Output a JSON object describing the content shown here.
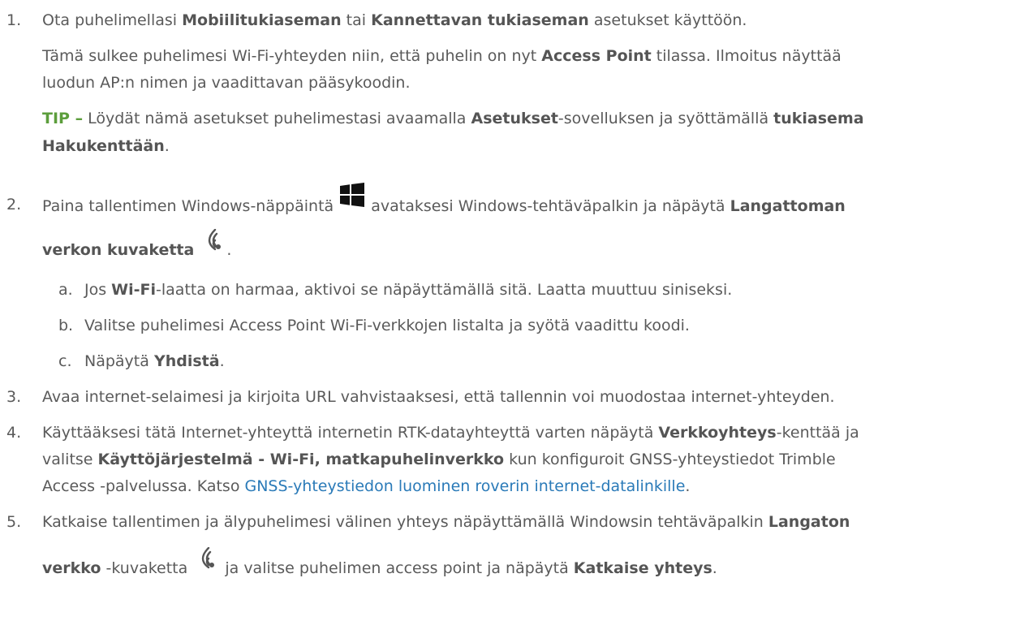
{
  "steps": [
    {
      "num": "1.",
      "l1_a": "Ota puhelimellasi ",
      "l1_b": "Mobiilitukiaseman",
      "l1_c": " tai ",
      "l1_d": "Kannettavan tukiaseman",
      "l1_e": " asetukset käyttöön.",
      "p_a": "Tämä sulkee puhelimesi Wi-Fi-yhteyden niin, että puhelin on nyt ",
      "p_b": "Access Point",
      "p_c": " tilassa. Ilmoitus näyttää",
      "p2": "luodun AP:n nimen ja vaadittavan pääsykoodin.",
      "tip": "TIP –",
      "t_a": " Löydät nämä asetukset puhelimestasi avaamalla ",
      "t_b": "Asetukset",
      "t_c": "-sovelluksen ja syöttämällä ",
      "t_d": "tukiasema",
      "t2_a": "Hakukenttään",
      "t2_b": "."
    },
    {
      "num": "2.",
      "a": "Paina tallentimen Windows-näppäintä ",
      "b": " avataksesi Windows-tehtäväpalkin ja näpäytä ",
      "c": "Langattoman",
      "d": "verkon kuvaketta",
      "e": ".",
      "sub": [
        {
          "letter": "a.",
          "a": "Jos ",
          "b": "Wi-Fi",
          "c": "-laatta on harmaa, aktivoi se näpäyttämällä sitä. Laatta muuttuu siniseksi."
        },
        {
          "letter": "b.",
          "a": "Valitse puhelimesi Access Point Wi-Fi-verkkojen listalta ja syötä vaadittu koodi."
        },
        {
          "letter": "c.",
          "a": "Näpäytä ",
          "b": "Yhdistä",
          "c": "."
        }
      ]
    },
    {
      "num": "3.",
      "a": "Avaa internet-selaimesi ja kirjoita URL vahvistaaksesi, että tallennin voi muodostaa internet-yhteyden."
    },
    {
      "num": "4.",
      "a": "Käyttääksesi tätä Internet-yhteyttä internetin RTK-datayhteyttä varten näpäytä ",
      "b": "Verkkoyhteys",
      "c": "-kenttää ja",
      "d": "valitse ",
      "e": "Käyttöjärjestelmä - Wi-Fi, matkapuhelinverkko",
      "f": " kun konfiguroit GNSS-yhteystiedot Trimble",
      "g": "Access -palvelussa. Katso ",
      "link": "GNSS-yhteystiedon luominen roverin internet-datalinkille",
      "h": "."
    },
    {
      "num": "5.",
      "a": "Katkaise tallentimen ja älypuhelimesi välinen yhteys näpäyttämällä Windowsin tehtäväpalkin ",
      "b": "Langaton",
      "c": "verkko",
      "d": " -kuvaketta ",
      "e": " ja valitse puhelimen access point ja näpäytä ",
      "f": "Katkaise yhteys",
      "g": "."
    }
  ],
  "icons": {
    "windows": "windows-logo-icon",
    "wifi": "wireless-network-icon"
  },
  "colors": {
    "text": "#5a5a5a",
    "tip": "#5c9e3c",
    "link": "#2a7ab8"
  }
}
